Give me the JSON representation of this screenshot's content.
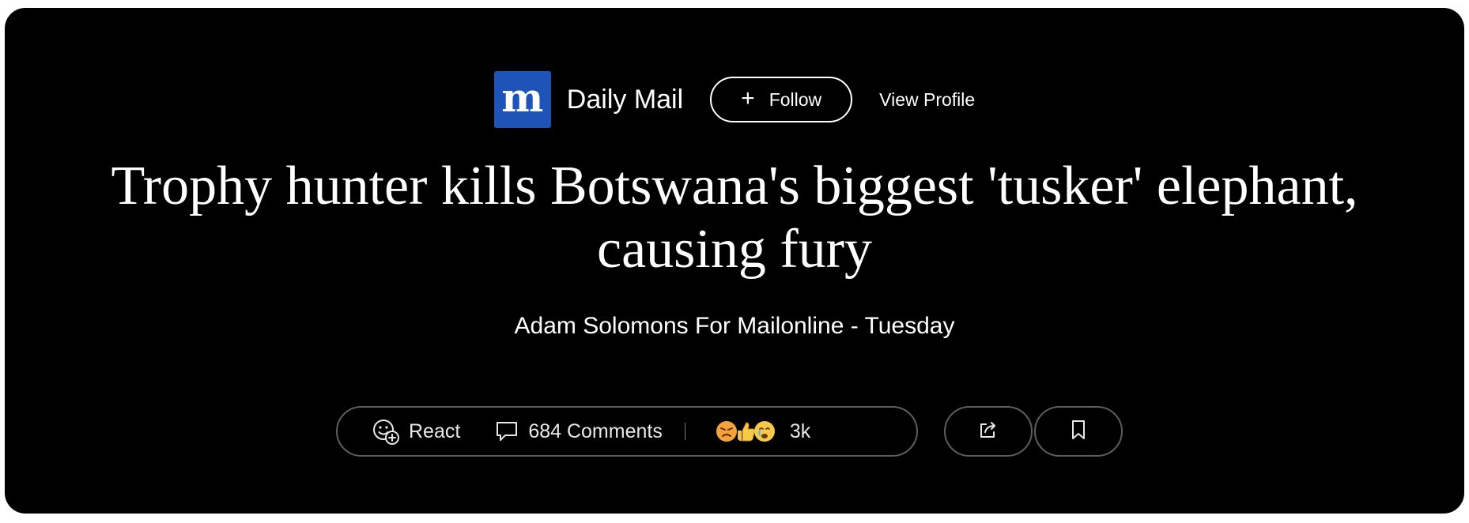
{
  "publisher": {
    "logo_letter": "m",
    "name": "Daily Mail",
    "follow_label": "Follow",
    "view_profile_label": "View Profile",
    "logo_color": "#1e54b7"
  },
  "article": {
    "headline": "Trophy hunter kills Botswana's biggest 'tusker' elephant, causing fury",
    "byline": "Adam Solomons For Mailonline - Tuesday"
  },
  "actions": {
    "react_label": "React",
    "comments_label": "684 Comments",
    "reaction_emojis": [
      "angry-face-emoji",
      "thumbs-up-emoji",
      "crying-face-emoji"
    ],
    "reaction_count": "3k",
    "share_icon": "share-icon",
    "save_icon": "bookmark-icon"
  }
}
